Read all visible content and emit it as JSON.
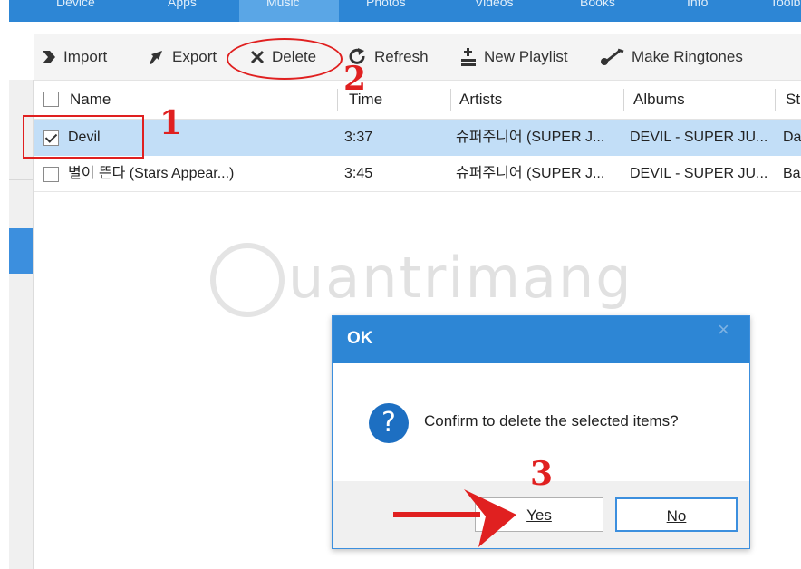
{
  "tabs": [
    "Device",
    "Apps",
    "Music",
    "Photos",
    "Videos",
    "Books",
    "Info",
    "Toolbox"
  ],
  "toolbar": {
    "import": "Import",
    "export": "Export",
    "delete": "Delete",
    "refresh": "Refresh",
    "new_playlist": "New Playlist",
    "make_ringtones": "Make Ringtones"
  },
  "table": {
    "headers": [
      "Name",
      "Time",
      "Artists",
      "Albums",
      "St"
    ],
    "rows": [
      {
        "name": "Devil",
        "time": "3:37",
        "artist": "슈퍼주니어 (SUPER J...",
        "album": "DEVIL - SUPER JU...",
        "extra": "Da",
        "checked": true
      },
      {
        "name": "별이 뜬다 (Stars Appear...)",
        "time": "3:45",
        "artist": "슈퍼주니어 (SUPER J...",
        "album": "DEVIL - SUPER JU...",
        "extra": "Ba",
        "checked": false
      }
    ]
  },
  "watermark": "uantrimang",
  "annotations": [
    "1",
    "2",
    "3"
  ],
  "dialog": {
    "title": "OK",
    "close": "×",
    "icon_glyph": "?",
    "message": "Confirm to delete the selected items?",
    "yes": "Yes",
    "no": "No"
  },
  "colors": {
    "accent": "#2d86d5",
    "selected_row": "#c2def7",
    "annotation": "#e02020"
  }
}
